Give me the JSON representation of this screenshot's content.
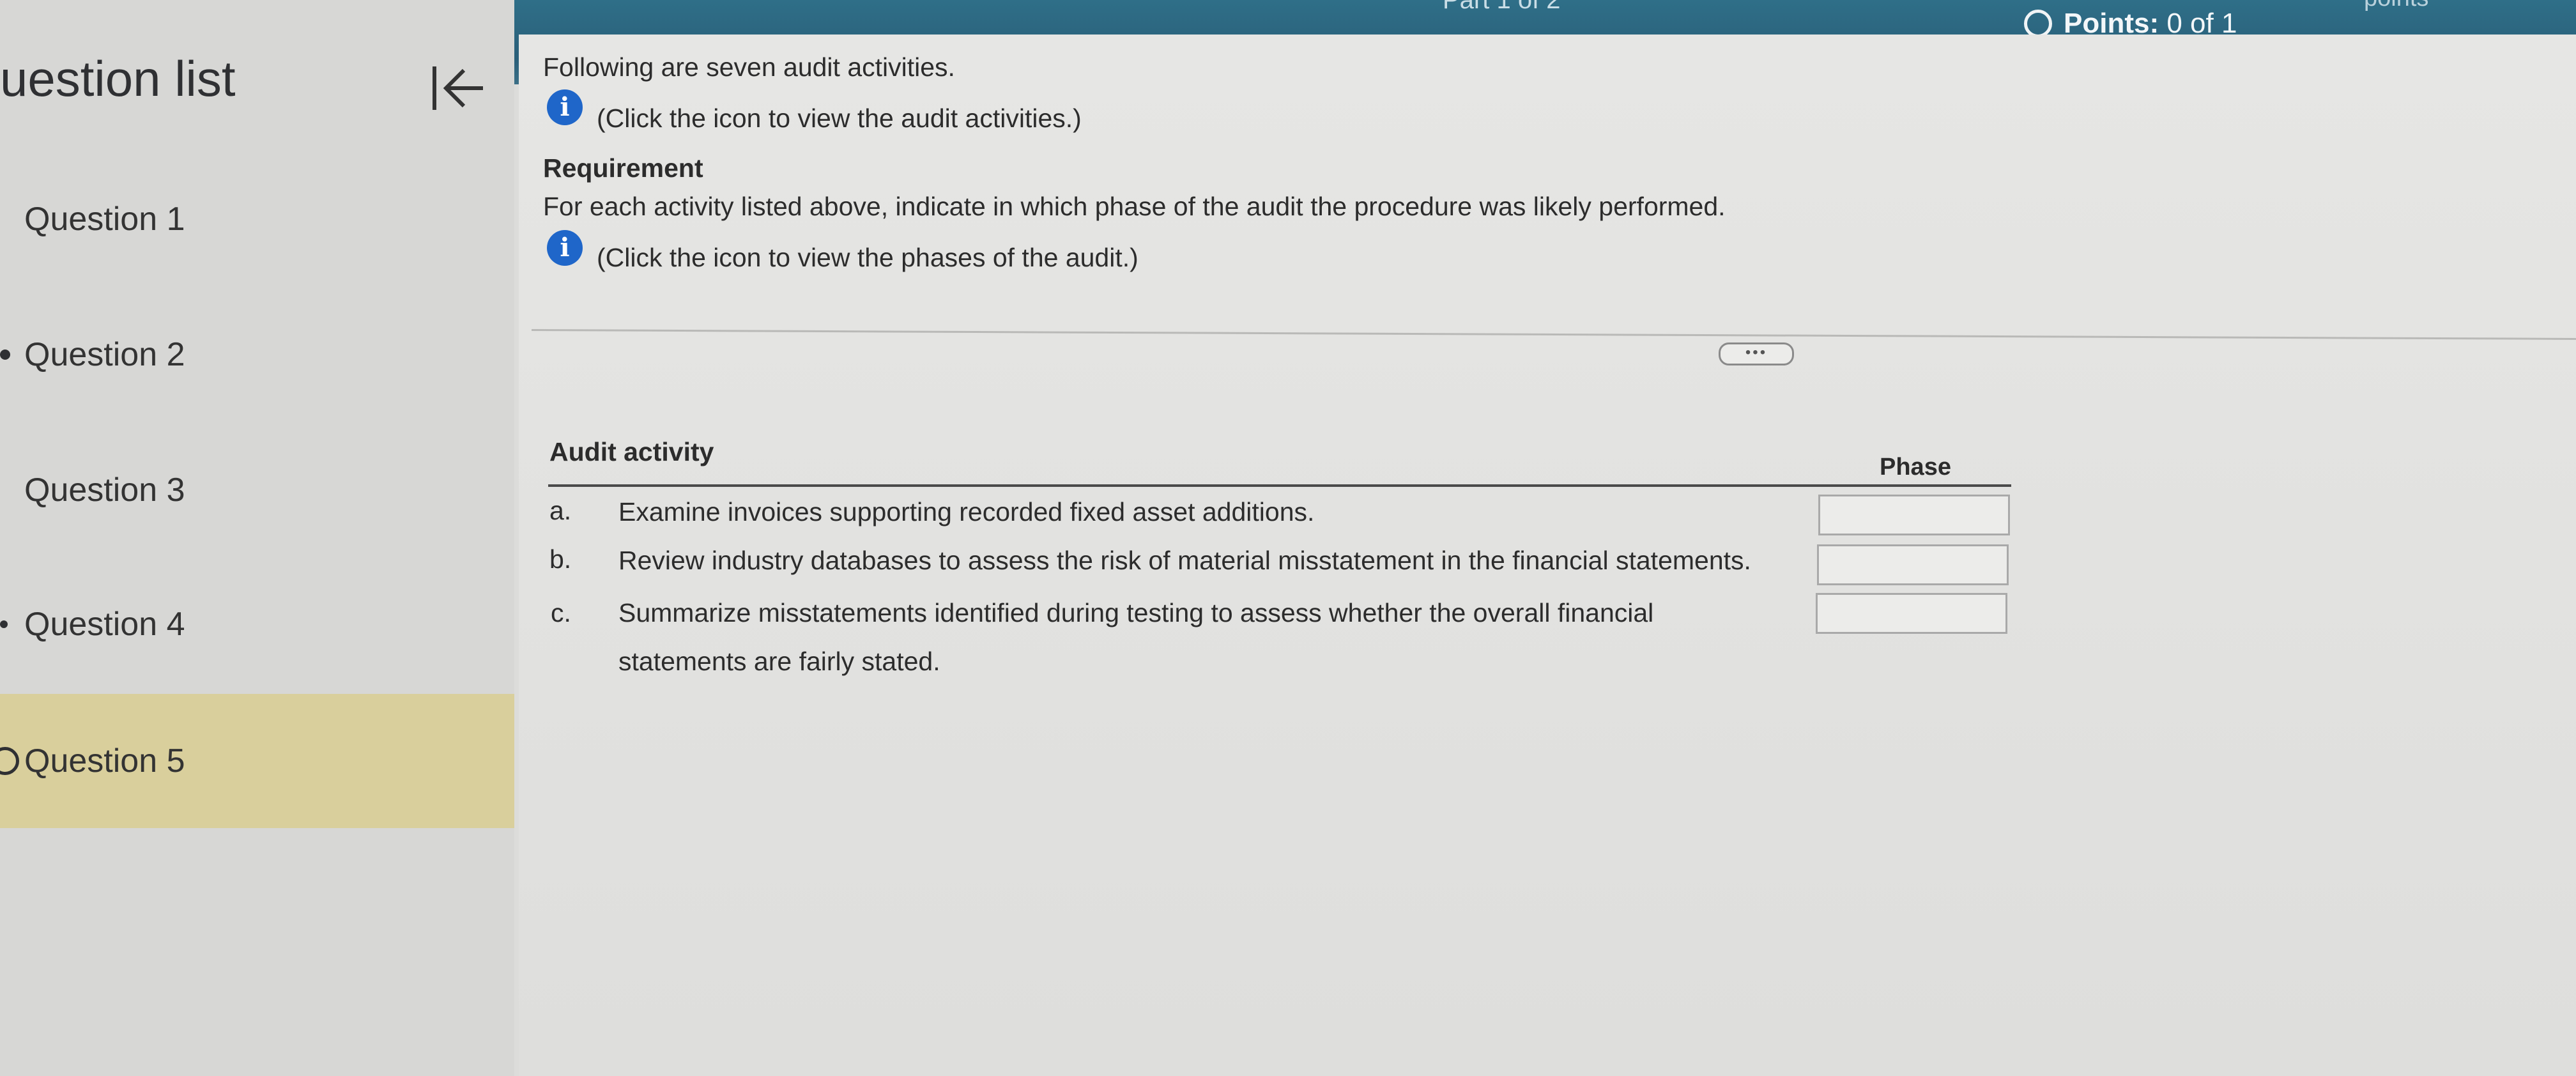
{
  "header": {
    "part": "Part 1 of 2",
    "points_top": "points",
    "points_label": "Points:",
    "points_value": "0 of 1"
  },
  "sidebar": {
    "title": "uestion list",
    "items": [
      {
        "label": "Question 1"
      },
      {
        "label": "Question 2"
      },
      {
        "label": "Question 3"
      },
      {
        "label": "Question 4"
      },
      {
        "label": "Question 5"
      }
    ]
  },
  "content": {
    "intro": "Following are seven audit activities.",
    "intro_link": "(Click the icon to view the audit activities.)",
    "requirement_heading": "Requirement",
    "requirement_text": "For each activity listed above, indicate in which phase of the audit the procedure was likely performed.",
    "requirement_link": "(Click the icon to view the phases of the audit.)",
    "more_label": "•••"
  },
  "table": {
    "col_activity": "Audit activity",
    "col_phase": "Phase",
    "rows": [
      {
        "letter": "a.",
        "text": "Examine invoices supporting recorded fixed asset additions.",
        "text2": "",
        "phase": ""
      },
      {
        "letter": "b.",
        "text": "Review industry databases to assess the risk of material misstatement in the financial statements.",
        "text2": "",
        "phase": ""
      },
      {
        "letter": "c.",
        "text": "Summarize misstatements identified during testing to assess whether the overall financial",
        "text2": "statements are fairly stated.",
        "phase": ""
      }
    ]
  },
  "colors": {
    "header_bg": "#2a5f79",
    "active_item_bg": "#d9cf9c",
    "info_icon": "#1f66c9"
  }
}
